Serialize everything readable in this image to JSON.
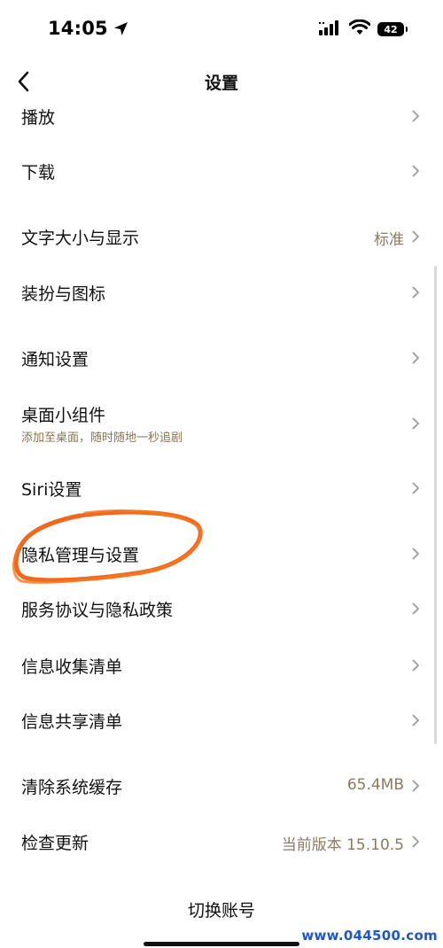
{
  "status_bar": {
    "time": "14:05",
    "battery": "42",
    "icons": [
      "location-arrow-icon",
      "signal-icon",
      "wifi-icon",
      "battery-icon"
    ]
  },
  "nav": {
    "title": "设置",
    "back_icon": "chevron-left-icon"
  },
  "settings": {
    "playback": {
      "label": "播放"
    },
    "download": {
      "label": "下载"
    },
    "text_size": {
      "label": "文字大小与显示",
      "value": "标准"
    },
    "appearance": {
      "label": "装扮与图标"
    },
    "notifications": {
      "label": "通知设置"
    },
    "widget": {
      "label": "桌面小组件",
      "subtitle": "添加至桌面，随时随地一秒追剧"
    },
    "siri": {
      "label": "Siri设置"
    },
    "privacy": {
      "label": "隐私管理与设置"
    },
    "terms": {
      "label": "服务协议与隐私政策"
    },
    "info_collection": {
      "label": "信息收集清单"
    },
    "info_sharing": {
      "label": "信息共享清单"
    },
    "clear_cache": {
      "label": "清除系统缓存",
      "value": "65.4MB"
    },
    "check_update": {
      "label": "检查更新",
      "value": "当前版本 15.10.5"
    }
  },
  "footer": {
    "switch_account": "切换账号"
  },
  "watermark": "www.044500.com",
  "colors": {
    "accent_secondary_text": "#8c7a60",
    "scribble": "#f05a0a",
    "chevron": "#9a9a9a",
    "watermark": "#1f56c9"
  }
}
